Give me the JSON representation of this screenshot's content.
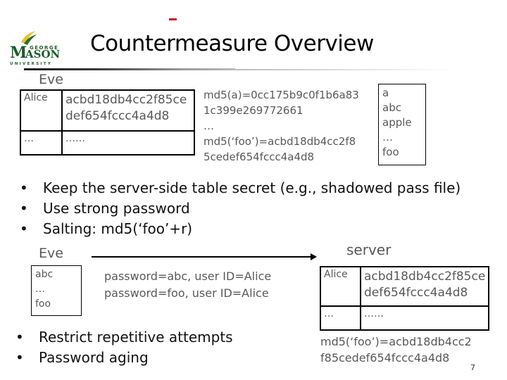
{
  "slide": {
    "title": "Countermeasure Overview",
    "logo": {
      "line1": "GEORGE",
      "line2": "MASON",
      "line3": "UNIVERSITY",
      "accent_green": "#1e5b2c",
      "accent_gold": "#e6c320"
    },
    "accent_red": "#c8141e",
    "page_number": "7"
  },
  "top": {
    "attacker_label": "Eve",
    "stolen_table": {
      "rows": [
        {
          "user": "Alice",
          "hash": "acbd18db4cc2f85cedef654fccc4a4d8",
          "hash_line1": "acbd18db4cc2f85ce",
          "hash_line2": "def654fccc4a4d8"
        },
        {
          "user": "…",
          "hash_line1": "……",
          "hash_line2": ""
        }
      ]
    },
    "precomputed": {
      "line1": "md5(a)=0cc175b9c0f1b6a83",
      "line2": "1c399e269772661",
      "line3": "…",
      "line4": "md5(‘foo’)=acbd18db4cc2f8",
      "line5": "5cedef654fccc4a4d8"
    },
    "dictionary": [
      "a",
      "abc",
      "apple",
      "…",
      "foo"
    ]
  },
  "bullets_top": [
    "Keep the server-side table secret (e.g., shadowed pass file)",
    "Use strong password",
    "Salting: md5(‘foo’+r)"
  ],
  "bottom": {
    "attacker_label": "Eve",
    "server_label": "server",
    "dictionary": [
      "abc",
      "…",
      "foo"
    ],
    "attempts": [
      "password=abc, user ID=Alice",
      "password=foo, user ID=Alice"
    ],
    "server_table": {
      "rows": [
        {
          "user": "Alice",
          "hash_line1": "acbd18db4cc2f85ce",
          "hash_line2": "def654fccc4a4d8"
        },
        {
          "user": "…",
          "hash_line1": "……",
          "hash_line2": ""
        }
      ]
    },
    "md5_note": {
      "line1": "md5(‘foo’)=acbd18db4cc2",
      "line2": "f85cedef654fccc4a4d8"
    }
  },
  "bullets_bottom": [
    "Restrict repetitive attempts",
    "Password aging"
  ],
  "bullet_glyph": "•"
}
